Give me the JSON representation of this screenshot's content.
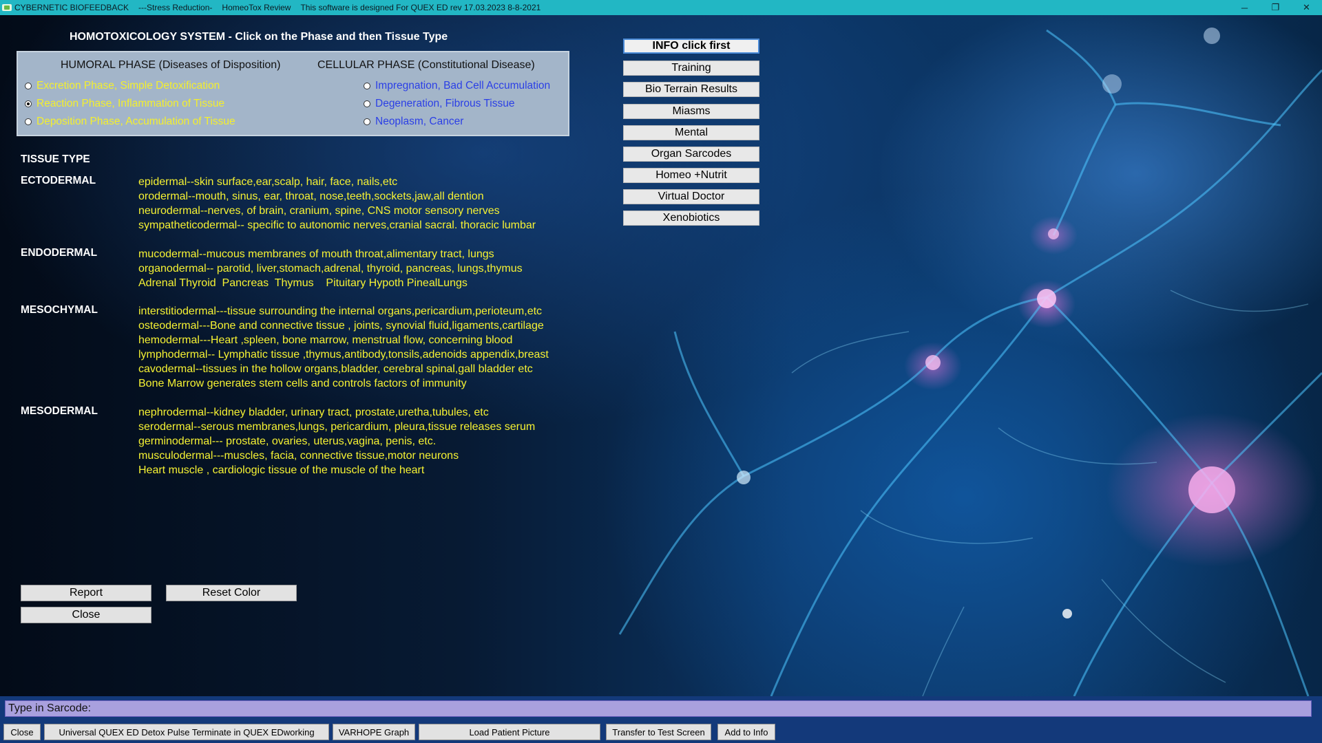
{
  "titlebar": {
    "app_name": "CYBERNETIC BIOFEEDBACK",
    "segment1": "---Stress Reduction-",
    "segment2": "HomeoTox Review",
    "segment3": "This software is designed For QUEX ED rev 17.03.2023 8-8-2021",
    "minimize": "─",
    "restore": "❐",
    "close": "✕"
  },
  "heading": "HOMOTOXICOLOGY SYSTEM - Click on the Phase and then Tissue Type",
  "phases": {
    "humoral_title": "HUMORAL PHASE (Diseases of Disposition)",
    "cellular_title": "CELLULAR PHASE (Constitutional Disease)",
    "humoral": [
      {
        "label": "Excretion Phase, Simple Detoxification",
        "selected": false
      },
      {
        "label": "Reaction Phase, Inflammation of Tissue",
        "selected": true
      },
      {
        "label": "Deposition Phase, Accumulation of Tissue",
        "selected": false
      }
    ],
    "cellular": [
      {
        "label": "Impregnation, Bad Cell Accumulation",
        "selected": false
      },
      {
        "label": "Degeneration, Fibrous Tissue",
        "selected": false
      },
      {
        "label": "Neoplasm, Cancer",
        "selected": false
      }
    ]
  },
  "tissue": {
    "title": "TISSUE TYPE",
    "groups": [
      {
        "name": "ECTODERMAL",
        "lines": [
          "epidermal--skin surface,ear,scalp, hair, face, nails,etc",
          "orodermal--mouth, sinus, ear, throat, nose,teeth,sockets,jaw,all dention",
          "neurodermal--nerves, of brain, cranium, spine, CNS motor sensory nerves",
          "sympatheticodermal-- specific to autonomic nerves,cranial sacral. thoracic lumbar"
        ]
      },
      {
        "name": "ENDODERMAL",
        "lines": [
          "mucodermal--mucous membranes of mouth throat,alimentary tract, lungs",
          "organodermal-- parotid, liver,stomach,adrenal, thyroid, pancreas, lungs,thymus",
          "Adrenal Thyroid  Pancreas  Thymus    Pituitary Hypoth PinealLungs"
        ]
      },
      {
        "name": "MESOCHYMAL",
        "lines": [
          "interstitiodermal---tissue surrounding the internal organs,pericardium,perioteum,etc",
          "osteodermal---Bone and connective tissue , joints, synovial fluid,ligaments,cartilage",
          "hemodermal---Heart ,spleen, bone marrow, menstrual flow, concerning blood",
          "lymphodermal-- Lymphatic tissue ,thymus,antibody,tonsils,adenoids appendix,breast",
          "cavodermal--tissues in the hollow organs,bladder, cerebral spinal,gall bladder etc",
          "Bone Marrow generates stem cells and controls factors of immunity"
        ]
      },
      {
        "name": "MESODERMAL",
        "lines": [
          "nephrodermal--kidney bladder, urinary tract, prostate,uretha,tubules, etc",
          "serodermal--serous membranes,lungs, pericardium, pleura,tissue releases serum",
          "germinodermal--- prostate, ovaries, uterus,vagina, penis, etc.",
          "musculodermal---muscles, facia, connective tissue,motor neurons",
          "Heart muscle , cardiologic tissue of the muscle of the heart"
        ]
      }
    ]
  },
  "menu": [
    "INFO click first",
    "Training",
    "Bio Terrain Results",
    "Miasms",
    "Mental",
    "Organ Sarcodes",
    "Homeo +Nutrit",
    "Virtual Doctor",
    "Xenobiotics"
  ],
  "actions": {
    "report": "Report",
    "reset_color": "Reset Color",
    "close": "Close"
  },
  "bottom": {
    "sarcode_prompt": "Type in Sarcode:",
    "buttons": [
      "Close",
      "Universal QUEX ED Detox Pulse Terminate in QUEX EDworking",
      "VARHOPE Graph",
      "Load Patient Picture",
      "Transfer to Test Screen",
      "Add to Info"
    ]
  }
}
